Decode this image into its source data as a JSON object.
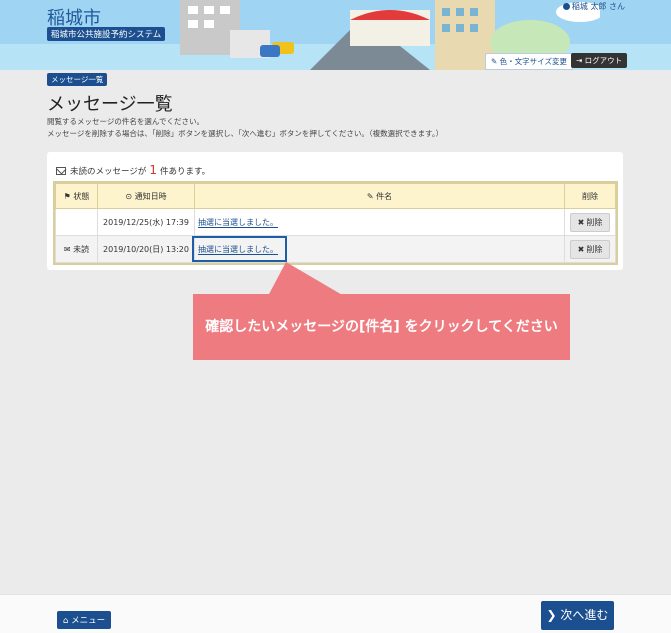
{
  "header": {
    "city_title": "稲城市",
    "system_name": "稲城市公共施設予約システム",
    "user_name": "稲城 太郎 さん",
    "font_size_button": "色・文字サイズ変更",
    "logout_button": "ログアウト"
  },
  "page": {
    "breadcrumb": "メッセージ一覧",
    "title": "メッセージ一覧",
    "description_1": "閲覧するメッセージの件名を選んでください。",
    "description_2": "メッセージを削除する場合は、「削除」ボタンを選択し、「次へ進む」ボタンを押してください。（複数選択できます。）"
  },
  "unread": {
    "prefix": "未読のメッセージが",
    "count": "1",
    "suffix": "件あります。"
  },
  "table": {
    "headers": [
      "状態",
      "通知日時",
      "件名",
      "削除"
    ],
    "rows": [
      {
        "status": "",
        "date": "2019/12/25(水) 17:39",
        "subject": "抽選に当選しました。",
        "delete": "削除"
      },
      {
        "status": "未読",
        "date": "2019/10/20(日) 13:20",
        "subject": "抽選に当選しました。",
        "delete": "削除"
      }
    ]
  },
  "callout": {
    "text": "確認したいメッセージの[件名] をクリックしてください"
  },
  "footer": {
    "menu_button": "メニュー",
    "next_button": "次へ進む"
  },
  "colors": {
    "primary": "#1c4f8f",
    "accent_red": "#d9302c",
    "callout": "#ee7b80",
    "table_header": "#fdf3cc"
  }
}
